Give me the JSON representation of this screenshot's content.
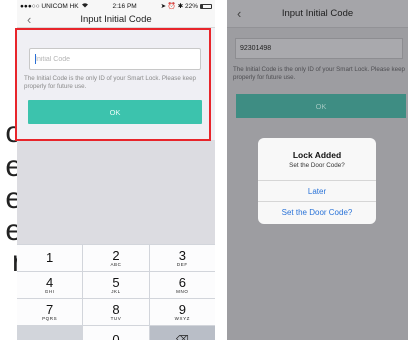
{
  "edge_text": [
    "o",
    "e",
    "e",
    "e",
    "r"
  ],
  "left_screen": {
    "status": {
      "carrier": "●●●○○ UNICOM HK",
      "wifi_icon": "wifi-icon",
      "time": "2:16 PM",
      "right_indicators": "➤ ⏰ ✱ 22%",
      "battery_level": 0.22
    },
    "nav": {
      "back_icon": "chevron-left-icon",
      "title": "Input Initial Code"
    },
    "form": {
      "input_placeholder": "Initial Code",
      "input_value": "",
      "hint": "The Initial Code is the only ID of your Smart Lock. Please keep properly for future use.",
      "ok_label": "OK",
      "accent_color": "#3cc3ad",
      "highlight_color": "#e8252b"
    },
    "keypad": [
      {
        "num": "1",
        "letters": ""
      },
      {
        "num": "2",
        "letters": "ABC"
      },
      {
        "num": "3",
        "letters": "DEF"
      },
      {
        "num": "4",
        "letters": "GHI"
      },
      {
        "num": "5",
        "letters": "JKL"
      },
      {
        "num": "6",
        "letters": "MNO"
      },
      {
        "num": "7",
        "letters": "PQRS"
      },
      {
        "num": "8",
        "letters": "TUV"
      },
      {
        "num": "9",
        "letters": "WXYZ"
      },
      {
        "num": "",
        "letters": ""
      },
      {
        "num": "0",
        "letters": ""
      },
      {
        "num": "⌫",
        "letters": ""
      }
    ]
  },
  "right_screen": {
    "nav": {
      "back_icon": "chevron-left-icon",
      "title": "Input Initial Code"
    },
    "input_value": "92301498",
    "hint": "The Initial Code is the only ID of your Smart Lock. Please keep properly for future use.",
    "ok_label": "OK",
    "alert": {
      "title": "Lock Added",
      "message": "Set the Door Code?",
      "later_label": "Later",
      "set_code_label": "Set the Door Code?"
    }
  }
}
